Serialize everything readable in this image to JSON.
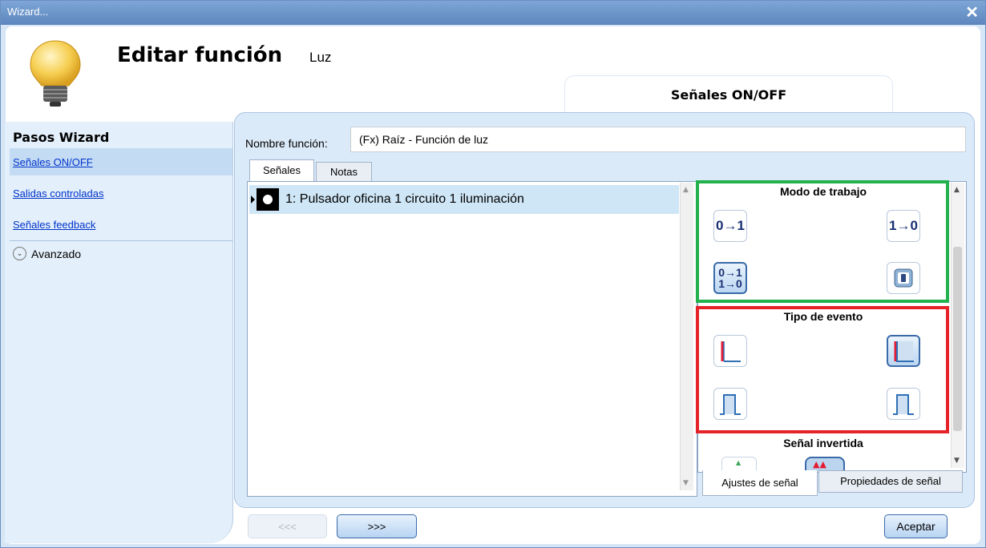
{
  "window": {
    "title": "Wizard...",
    "close_glyph": "✕"
  },
  "header": {
    "title": "Editar función",
    "subtitle": "Luz",
    "icon": "lightbulb-icon",
    "step_tab": "Señales ON/OFF"
  },
  "sidebar": {
    "title": "Pasos Wizard",
    "items": [
      {
        "label": "Señales ON/OFF",
        "selected": true
      },
      {
        "label": "Salidas controladas",
        "selected": false
      },
      {
        "label": "Señales feedback",
        "selected": false
      }
    ],
    "advanced": {
      "label": "Avanzado",
      "icon": "chevron-down-icon"
    }
  },
  "function_name": {
    "label": "Nombre función:",
    "value": "(Fx) Raíz - Función de luz"
  },
  "tabs": {
    "signals": "Señales",
    "notes": "Notas"
  },
  "signals": [
    {
      "label": "1: Pulsador oficina 1 circuito 1 iluminación",
      "icon": "pushbutton-icon"
    }
  ],
  "properties": {
    "work_mode": {
      "title": "Modo de trabajo",
      "options": [
        {
          "name": "0-to-1",
          "glyph": "0→1",
          "selected": false
        },
        {
          "name": "1-to-0",
          "glyph": "1→0",
          "selected": false
        },
        {
          "name": "both",
          "glyph_top": "0→1",
          "glyph_bottom": "1→0",
          "selected": true
        },
        {
          "name": "switch",
          "selected": false
        }
      ]
    },
    "event_type": {
      "title": "Tipo de evento"
    },
    "inverted_signal": {
      "title": "Señal invertida"
    },
    "tabs": {
      "settings": "Ajustes de señal",
      "properties": "Propiedades de señal"
    }
  },
  "buttons": {
    "prev": "<<<",
    "next": ">>>",
    "ok": "Aceptar"
  },
  "colors": {
    "green_frame": "#22b14c",
    "red_frame": "#e52228",
    "accent": "#3a6aa8"
  }
}
